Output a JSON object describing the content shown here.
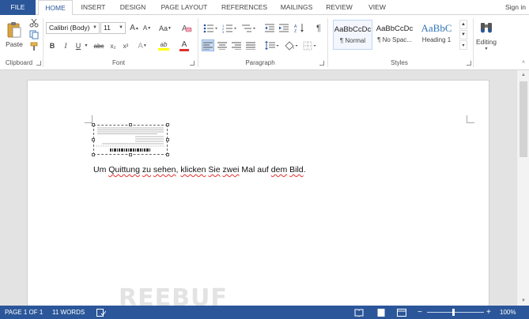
{
  "tabs": {
    "file": "FILE",
    "home": "HOME",
    "insert": "INSERT",
    "design": "DESIGN",
    "page_layout": "PAGE LAYOUT",
    "references": "REFERENCES",
    "mailings": "MAILINGS",
    "review": "REVIEW",
    "view": "VIEW",
    "sign_in": "Sign in"
  },
  "clipboard": {
    "paste_label": "Paste",
    "group_label": "Clipboard"
  },
  "font": {
    "family": "Calibri (Body)",
    "size": "11",
    "group_label": "Font",
    "bold": "B",
    "italic": "I",
    "underline": "U",
    "strikethrough": "abc",
    "subscript": "x₂",
    "superscript": "x²",
    "grow": "A",
    "shrink": "A",
    "change_case": "Aa",
    "text_effects": "A",
    "highlight": "ab",
    "font_color": "A"
  },
  "paragraph": {
    "group_label": "Paragraph"
  },
  "styles": {
    "group_label": "Styles",
    "items": [
      {
        "sample": "AaBbCcDc",
        "name": "¶ Normal"
      },
      {
        "sample": "AaBbCcDc",
        "name": "¶ No Spac..."
      },
      {
        "sample": "AaBbC",
        "name": "Heading 1"
      }
    ]
  },
  "editing": {
    "label": "Editing"
  },
  "document": {
    "body_parts": [
      "Um ",
      "Quittung",
      " ",
      "zu",
      " ",
      "sehen",
      ", ",
      "klicken",
      " ",
      "Sie",
      " ",
      "zwei",
      " Mal auf ",
      "dem",
      " ",
      "Bild",
      "."
    ]
  },
  "status": {
    "page": "PAGE 1 OF 1",
    "words": "11 WORDS",
    "zoom": "100%",
    "zoom_out": "−",
    "zoom_in": "+"
  },
  "watermark": "REEBUF",
  "colors": {
    "accent": "#2b579a",
    "highlight_yellow": "#ffff00",
    "font_red": "#e0302f"
  }
}
